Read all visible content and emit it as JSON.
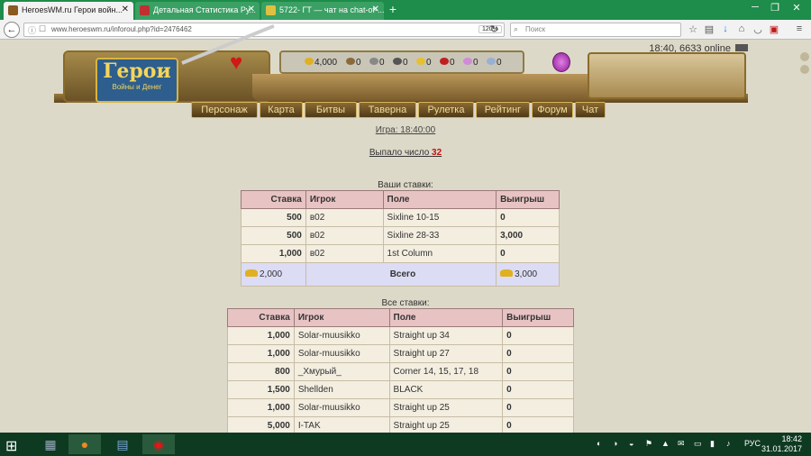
{
  "browser": {
    "tabs": [
      {
        "title": "HeroesWM.ru Герои войн...",
        "active": true
      },
      {
        "title": "Детальная Статистика Ру...",
        "active": false
      },
      {
        "title": "5722- ГТ — чат на chat-of-...",
        "active": false
      }
    ],
    "url": "www.heroeswm.ru/inforoul.php?id=2476462",
    "zoom": "120%",
    "search_placeholder": "Поиск"
  },
  "header": {
    "online_status": "18:40, 6633 online",
    "logo_title": "Герои",
    "logo_subtitle": "Войны и Денег",
    "resources": [
      {
        "value": "4,000",
        "color": "#e0b020"
      },
      {
        "value": "0",
        "color": "#8a6a3a"
      },
      {
        "value": "0",
        "color": "#888888"
      },
      {
        "value": "0",
        "color": "#555555"
      },
      {
        "value": "0",
        "color": "#e6c030"
      },
      {
        "value": "0",
        "color": "#c02020"
      },
      {
        "value": "0",
        "color": "#d08ad8"
      },
      {
        "value": "0",
        "color": "#9ab0d0"
      }
    ]
  },
  "menu": [
    "Персонаж",
    "Карта",
    "Битвы",
    "Таверна",
    "Рулетка",
    "Рейтинг",
    "Форум",
    "Чат"
  ],
  "game_time": "Игра: 18:40:00",
  "rolled": {
    "label": "Выпало число",
    "number": "32"
  },
  "your_bets": {
    "title": "Ваши ставки:",
    "headers": [
      "Ставка",
      "Игрок",
      "Поле",
      "Выигрыш"
    ],
    "rows": [
      [
        "500",
        "в02",
        "Sixline 10-15",
        "0"
      ],
      [
        "500",
        "в02",
        "Sixline 28-33",
        "3,000"
      ],
      [
        "1,000",
        "в02",
        "1st Column",
        "0"
      ]
    ],
    "total": {
      "bet": "2,000",
      "label": "Всего",
      "win": "3,000"
    }
  },
  "all_bets": {
    "title": "Все ставки:",
    "headers": [
      "Ставка",
      "Игрок",
      "Поле",
      "Выигрыш"
    ],
    "rows": [
      [
        "1,000",
        "Solar-muusikko",
        "Straight up 34",
        "0"
      ],
      [
        "1,000",
        "Solar-muusikko",
        "Straight up 27",
        "0"
      ],
      [
        "800",
        "_Хмурый_",
        "Corner 14, 15, 17, 18",
        "0"
      ],
      [
        "1,500",
        "Shellden",
        "BLACK",
        "0"
      ],
      [
        "1,000",
        "Solar-muusikko",
        "Straight up 25",
        "0"
      ],
      [
        "5,000",
        "I-TAK",
        "Straight up 25",
        "0"
      ]
    ]
  },
  "taskbar": {
    "lang": "РУС",
    "time": "18:42",
    "date": "31.01.2017"
  }
}
